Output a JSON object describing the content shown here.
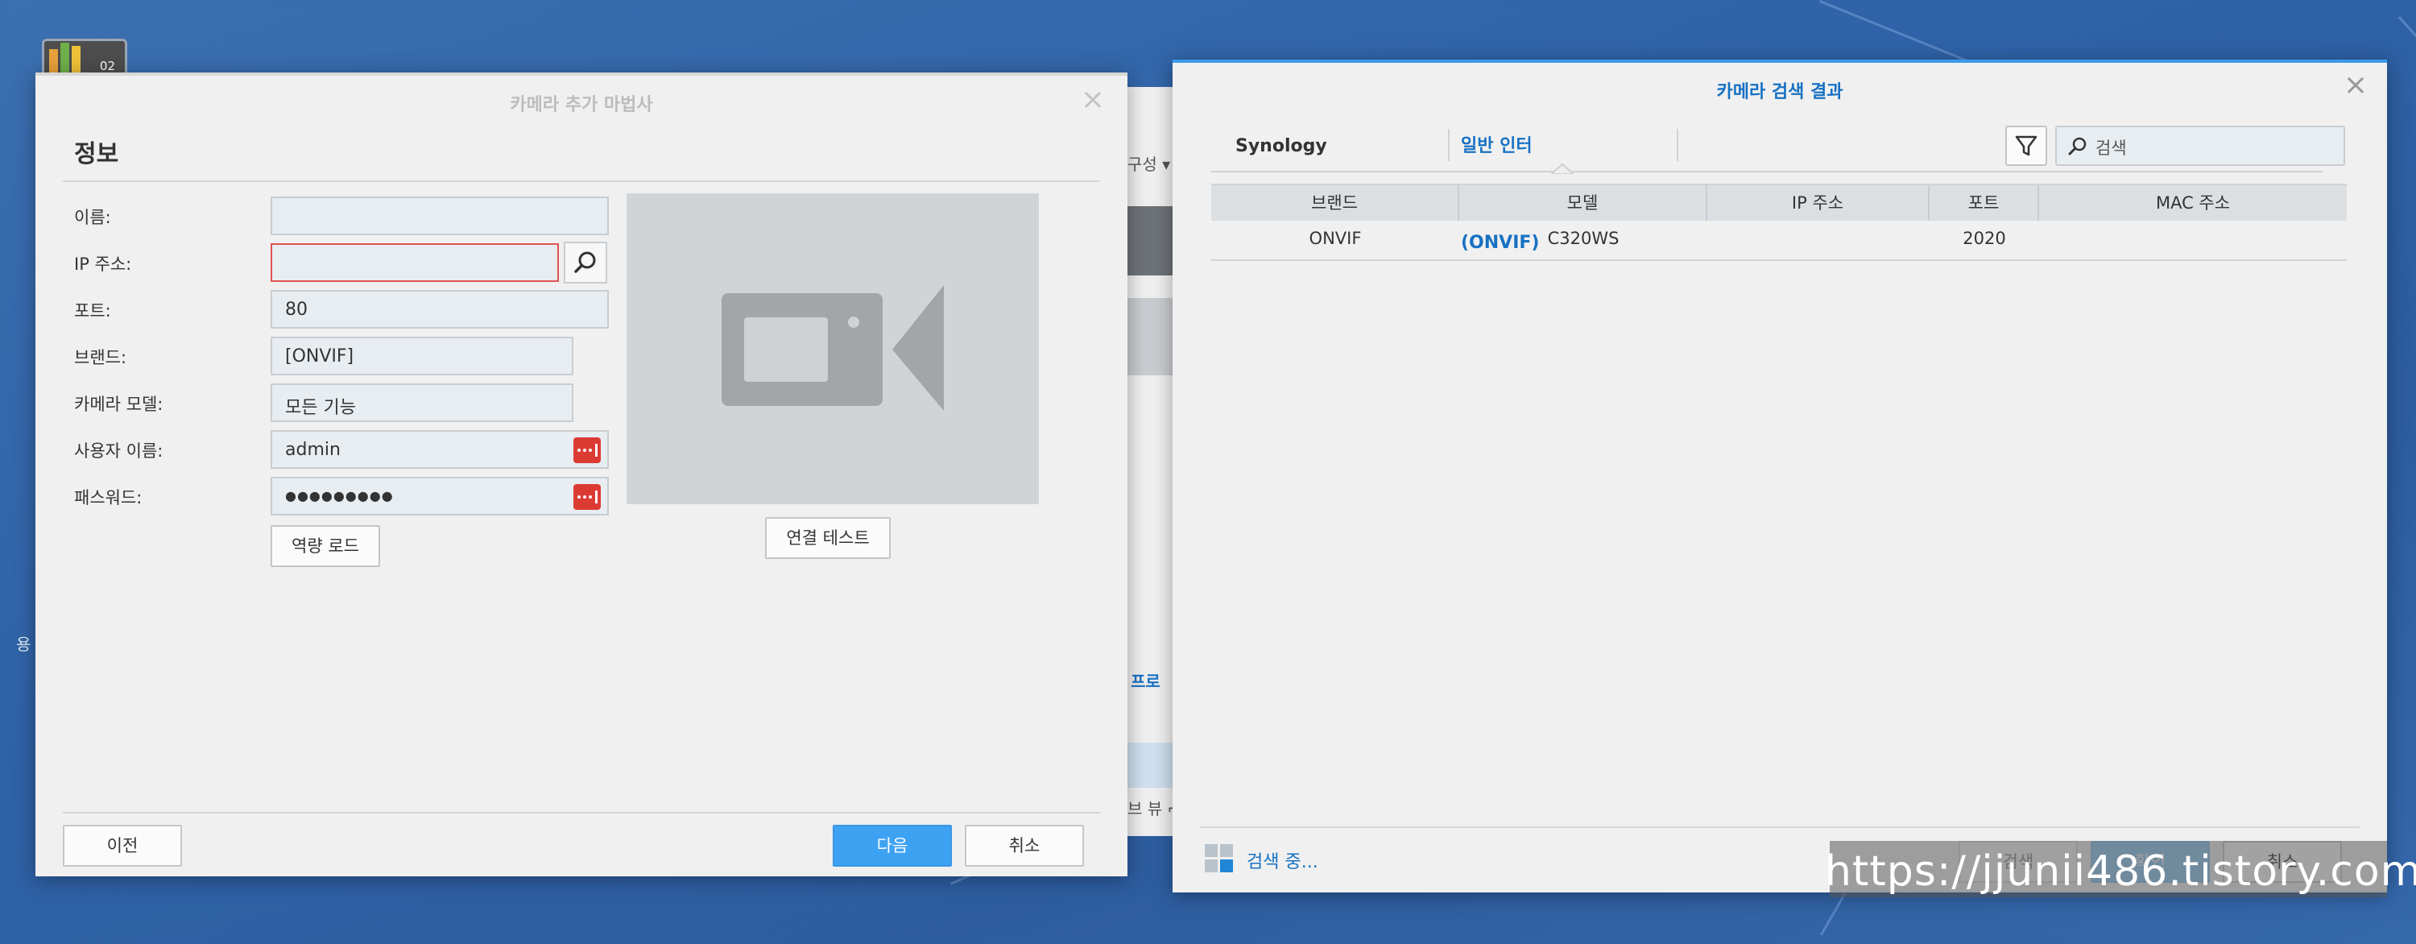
{
  "desktop": {
    "icon_number": "02",
    "edge_letter": "용"
  },
  "wizard": {
    "title": "카메라 추가 마법사",
    "section_title": "정보",
    "labels": {
      "name": "이름:",
      "ip": "IP 주소:",
      "port": "포트:",
      "brand": "브랜드:",
      "model": "카메라 모델:",
      "username": "사용자 이름:",
      "password": "패스워드:"
    },
    "values": {
      "name": "",
      "ip": "",
      "port": "80",
      "brand": "[ONVIF]",
      "model": "모든 기능",
      "username": "admin",
      "password": "●●●●●●●●●"
    },
    "buttons": {
      "load_capability": "역량 로드",
      "test_connection": "연결 테스트",
      "prev": "이전",
      "next": "다음",
      "cancel": "취소"
    }
  },
  "background_window": {
    "menu_label": "구성",
    "link_label": "프로",
    "footer_label": "브 뷰 ⌐"
  },
  "results": {
    "title": "카메라 검색 결과",
    "tabs": [
      {
        "label": "Synology 지원 카메라",
        "active": false
      },
      {
        "label": "일반 인터페이스(ONVIF)",
        "active": true
      }
    ],
    "search_placeholder": "검색",
    "columns": [
      "브랜드",
      "모델",
      "IP 주소",
      "포트",
      "MAC 주소"
    ],
    "rows": [
      {
        "brand": "ONVIF",
        "model": "C320WS",
        "ip": "",
        "port": "2020",
        "mac": ""
      }
    ],
    "status": "검색 중...",
    "buttons": {
      "search": "검색",
      "ok": "확인",
      "cancel": "취소"
    },
    "watermark": "https://jjunii486.tistory.com"
  },
  "colors": {
    "accent": "#1771c3",
    "primary_button": "#3ea2f3",
    "error_border": "#e05252",
    "password_button": "#dc3b34",
    "desktop": "#2f62a8"
  }
}
